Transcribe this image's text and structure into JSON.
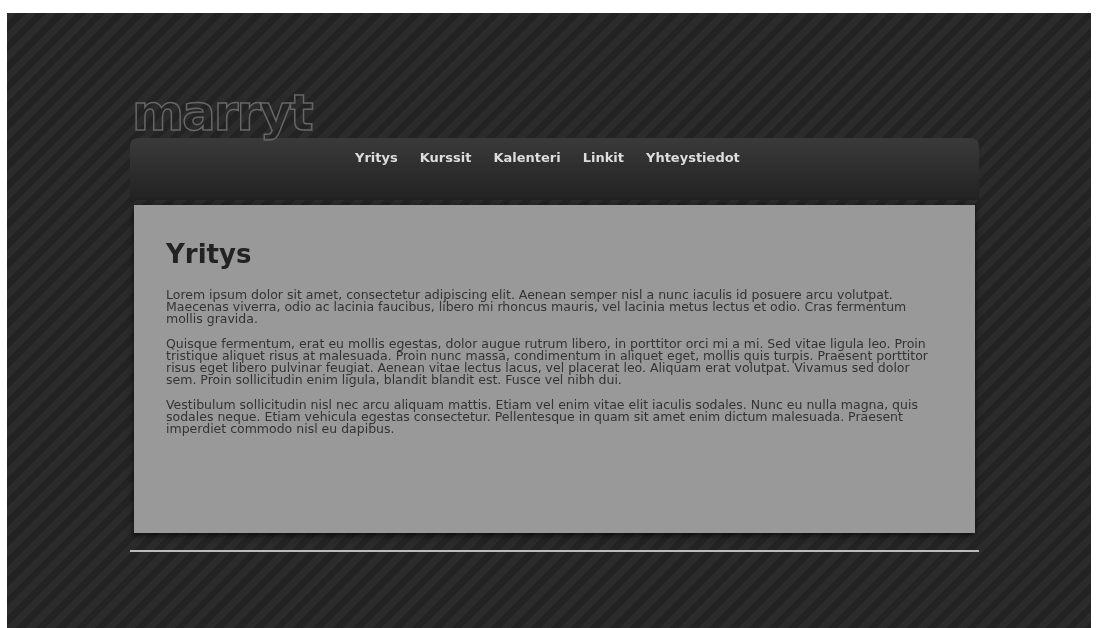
{
  "logo": "marryt",
  "nav": [
    {
      "label": "Yritys"
    },
    {
      "label": "Kurssit"
    },
    {
      "label": "Kalenteri"
    },
    {
      "label": "Linkit"
    },
    {
      "label": "Yhteystiedot"
    }
  ],
  "content": {
    "heading": "Yritys",
    "paragraphs": [
      "Lorem ipsum dolor sit amet, consectetur adipiscing elit. Aenean semper nisl a nunc iaculis id posuere arcu volutpat. Maecenas viverra, odio ac lacinia faucibus, libero mi rhoncus mauris, vel lacinia metus lectus et odio. Cras fermentum mollis gravida.",
      "Quisque fermentum, erat eu mollis egestas, dolor augue rutrum libero, in porttitor orci mi a mi. Sed vitae ligula leo. Proin tristique aliquet risus at malesuada. Proin nunc massa, condimentum in aliquet eget, mollis quis turpis. Praesent porttitor risus eget libero pulvinar feugiat. Aenean vitae lectus lacus, vel placerat leo. Aliquam erat volutpat. Vivamus sed dolor sem. Proin sollicitudin enim ligula, blandit blandit est. Fusce vel nibh dui.",
      "Vestibulum sollicitudin nisl nec arcu aliquam mattis. Etiam vel enim vitae elit iaculis sodales. Nunc eu nulla magna, quis sodales neque. Etiam vehicula egestas consectetur. Pellentesque in quam sit amet enim dictum malesuada. Praesent imperdiet commodo nisl eu dapibus."
    ]
  }
}
